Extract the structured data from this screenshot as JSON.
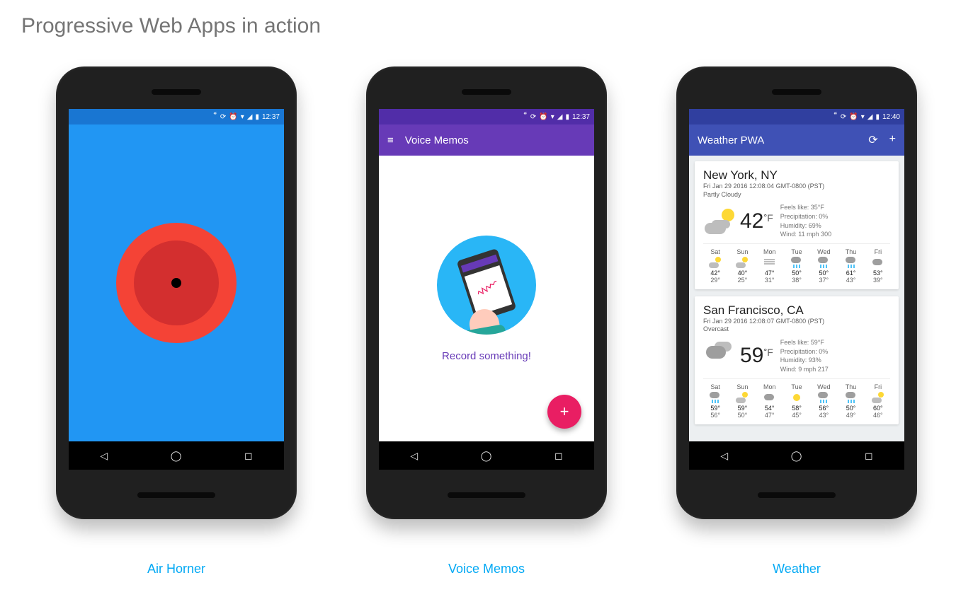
{
  "page": {
    "title": "Progressive Web Apps in action"
  },
  "links": {
    "airhorner": "Air Horner",
    "voicememos": "Voice Memos",
    "weather": "Weather"
  },
  "statusbar": {
    "time1": "12:37",
    "time2": "12:37",
    "time3": "12:40"
  },
  "voicememos": {
    "appbar_title": "Voice Memos",
    "caption": "Record something!",
    "fab_label": "+"
  },
  "weather": {
    "appbar_title": "Weather PWA",
    "cards": [
      {
        "city": "New York, NY",
        "timestamp": "Fri Jan 29 2016 12:08:04 GMT-0800 (PST)",
        "condition": "Partly Cloudy",
        "temp": "42",
        "unit": "°F",
        "details": {
          "feels": "Feels like: 35°F",
          "precip": "Precipitation: 0%",
          "humidity": "Humidity: 69%",
          "wind": "Wind: 11 mph 300"
        },
        "forecast": [
          {
            "d": "Sat",
            "icon": "mini-sun-cloud",
            "hi": "42°",
            "lo": "29°"
          },
          {
            "d": "Sun",
            "icon": "mini-sun-cloud",
            "hi": "40°",
            "lo": "25°"
          },
          {
            "d": "Mon",
            "icon": "mini-fog",
            "hi": "47°",
            "lo": "31°"
          },
          {
            "d": "Tue",
            "icon": "rain",
            "hi": "50°",
            "lo": "38°"
          },
          {
            "d": "Wed",
            "icon": "rain",
            "hi": "50°",
            "lo": "37°"
          },
          {
            "d": "Thu",
            "icon": "rain",
            "hi": "61°",
            "lo": "43°"
          },
          {
            "d": "Fri",
            "icon": "mini-cloud",
            "hi": "53°",
            "lo": "39°"
          }
        ]
      },
      {
        "city": "San Francisco, CA",
        "timestamp": "Fri Jan 29 2016 12:08:07 GMT-0800 (PST)",
        "condition": "Overcast",
        "temp": "59",
        "unit": "°F",
        "details": {
          "feels": "Feels like: 59°F",
          "precip": "Precipitation: 0%",
          "humidity": "Humidity: 93%",
          "wind": "Wind: 9 mph 217"
        },
        "forecast": [
          {
            "d": "Sat",
            "icon": "rain",
            "hi": "59°",
            "lo": "56°"
          },
          {
            "d": "Sun",
            "icon": "mini-sun-cloud",
            "hi": "59°",
            "lo": "50°"
          },
          {
            "d": "Mon",
            "icon": "mini-cloud",
            "hi": "54°",
            "lo": "47°"
          },
          {
            "d": "Tue",
            "icon": "mini-sun",
            "hi": "58°",
            "lo": "45°"
          },
          {
            "d": "Wed",
            "icon": "rain",
            "hi": "56°",
            "lo": "43°"
          },
          {
            "d": "Thu",
            "icon": "rain",
            "hi": "50°",
            "lo": "49°"
          },
          {
            "d": "Fri",
            "icon": "mini-sun-cloud",
            "hi": "60°",
            "lo": "46°"
          }
        ]
      }
    ]
  }
}
